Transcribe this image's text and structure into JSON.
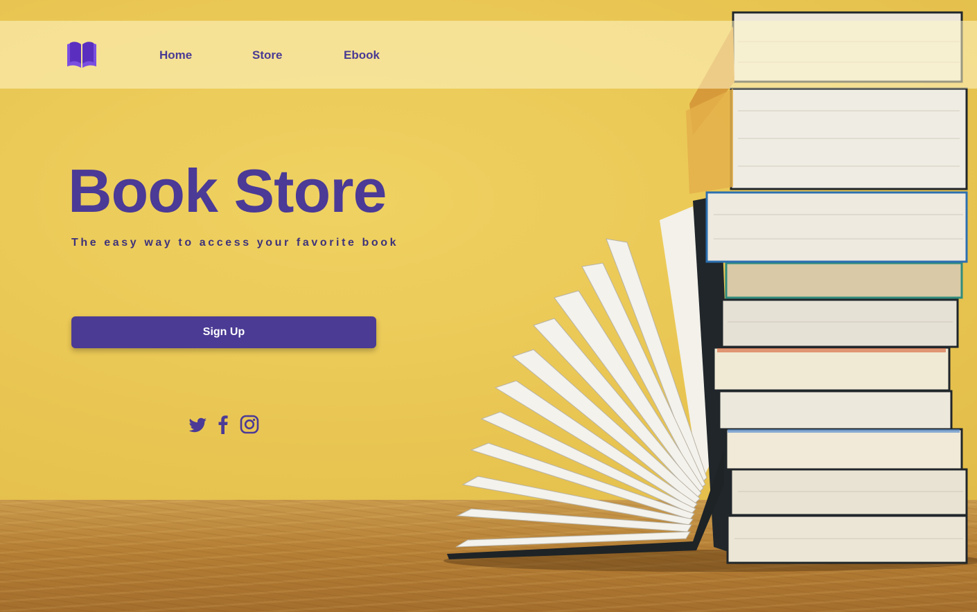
{
  "nav": {
    "logo_icon": "open-book-icon",
    "items": [
      {
        "label": "Home"
      },
      {
        "label": "Store"
      },
      {
        "label": "Ebook"
      }
    ]
  },
  "hero": {
    "title": "Book Store",
    "subtitle": "The easy way to access your favorite book",
    "cta_label": "Sign Up"
  },
  "social": [
    "twitter-icon",
    "facebook-icon",
    "instagram-icon"
  ],
  "colors": {
    "brand_purple": "#4b3a96",
    "background_yellow": "#e9c653",
    "nav_overlay": "#f6ecb4",
    "button": "#4b3b94"
  }
}
